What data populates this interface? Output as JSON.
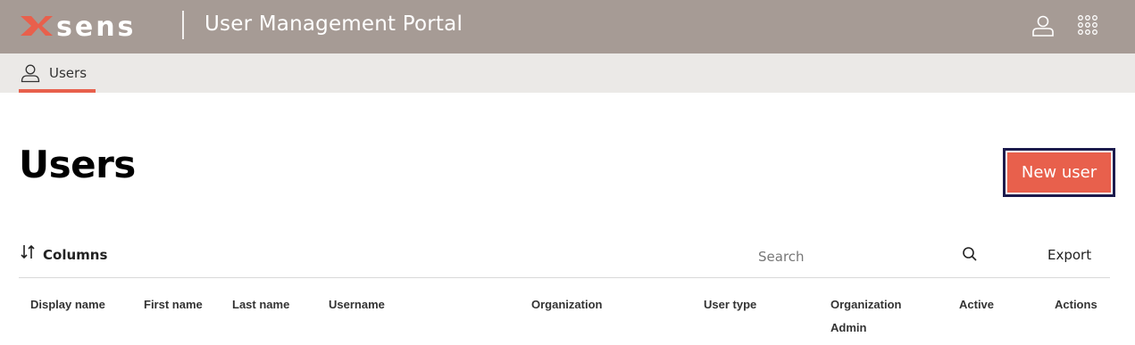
{
  "header": {
    "brand": "xsens",
    "title": "User Management Portal",
    "account_icon": "user-icon",
    "apps_icon": "grid-icon",
    "background": "#a69b95"
  },
  "subnav": {
    "tabs": [
      {
        "label": "Users",
        "icon": "user-icon",
        "active": true
      }
    ],
    "accent": "#e8604c",
    "background": "#ebe9e7"
  },
  "main": {
    "page_title": "Users",
    "new_user_label": "New user",
    "toolbar": {
      "columns_label": "Columns",
      "search_placeholder": "Search",
      "export_label": "Export"
    },
    "table": {
      "columns": [
        "Display name",
        "First name",
        "Last name",
        "Username",
        "Organization",
        "User type",
        "Organization Admin",
        "Active",
        "Actions"
      ]
    }
  },
  "colors": {
    "accent": "#e8604c",
    "focus_ring": "#1c1b4d"
  }
}
